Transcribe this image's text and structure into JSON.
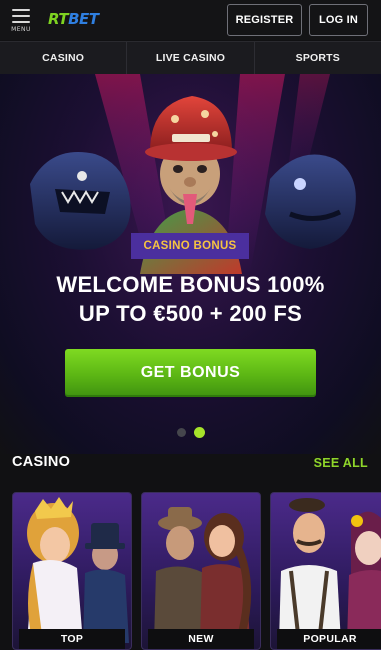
{
  "header": {
    "menu_label": "MENU",
    "logo_part1": "RT",
    "logo_part2": "BET",
    "register_label": "REGISTER",
    "login_label": "LOG IN"
  },
  "nav": {
    "items": [
      "CASINO",
      "LIVE CASINO",
      "SPORTS"
    ]
  },
  "hero": {
    "badge": "CASINO BONUS",
    "title_line1": "WELCOME BONUS 100%",
    "title_line2": "UP TO €500 + 200 FS",
    "cta_label": "GET BONUS",
    "slides_total": 2,
    "active_slide": 2
  },
  "casino": {
    "title": "CASINO",
    "see_all": "SEE ALL",
    "cards": [
      {
        "label": "TOP"
      },
      {
        "label": "NEW"
      },
      {
        "label": "POPULAR"
      }
    ]
  },
  "colors": {
    "accent_green": "#8fd62a",
    "badge_bg": "#4b2f9e",
    "badge_text": "#f6c442",
    "logo_green": "#7ed321",
    "logo_blue": "#2f7fe0",
    "background": "#111113"
  }
}
